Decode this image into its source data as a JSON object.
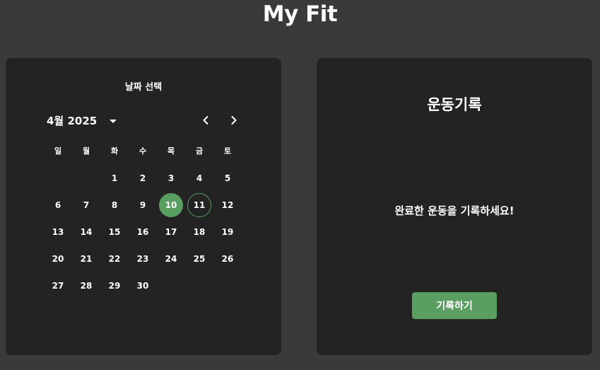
{
  "app": {
    "title": "My Fit"
  },
  "calendar": {
    "title": "날짜 선택",
    "month_label": "4월 2025",
    "selected_day": "10",
    "today": "11",
    "weekdays": [
      "일",
      "월",
      "화",
      "수",
      "목",
      "금",
      "토"
    ],
    "weeks": [
      [
        "",
        "",
        "1",
        "2",
        "3",
        "4",
        "5"
      ],
      [
        "6",
        "7",
        "8",
        "9",
        "10",
        "11",
        "12"
      ],
      [
        "13",
        "14",
        "15",
        "16",
        "17",
        "18",
        "19"
      ],
      [
        "20",
        "21",
        "22",
        "23",
        "24",
        "25",
        "26"
      ],
      [
        "27",
        "28",
        "29",
        "30",
        "",
        "",
        ""
      ]
    ]
  },
  "record": {
    "title": "운동기록",
    "message": "완료한 운동을 기록하세요!",
    "button_label": "기록하기"
  },
  "colors": {
    "background": "#3a3a3a",
    "panel": "#232323",
    "accent": "#5a9e62"
  },
  "icons": {
    "prev": "chevron-left-icon",
    "next": "chevron-right-icon",
    "dropdown": "caret-down-icon"
  }
}
